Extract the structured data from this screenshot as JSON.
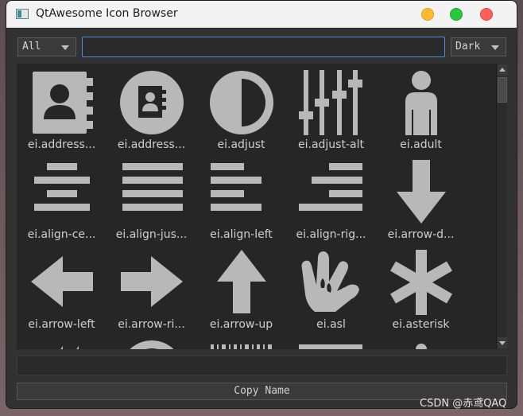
{
  "window": {
    "title": "QtAwesome Icon Browser"
  },
  "toolbar": {
    "filter_value": "All",
    "search_value": "",
    "theme_value": "Dark"
  },
  "icons": [
    {
      "label": "ei.address...",
      "icon": "address-book-icon"
    },
    {
      "label": "ei.address...",
      "icon": "address-book-alt-icon"
    },
    {
      "label": "ei.adjust",
      "icon": "adjust-icon"
    },
    {
      "label": "ei.adjust-alt",
      "icon": "adjust-alt-icon"
    },
    {
      "label": "ei.adult",
      "icon": "adult-icon"
    },
    {
      "label": "ei.align-ce...",
      "icon": "align-center-icon"
    },
    {
      "label": "ei.align-jus...",
      "icon": "align-justify-icon"
    },
    {
      "label": "ei.align-left",
      "icon": "align-left-icon"
    },
    {
      "label": "ei.align-rig...",
      "icon": "align-right-icon"
    },
    {
      "label": "ei.arrow-d...",
      "icon": "arrow-down-icon"
    },
    {
      "label": "ei.arrow-left",
      "icon": "arrow-left-icon"
    },
    {
      "label": "ei.arrow-ri...",
      "icon": "arrow-right-icon"
    },
    {
      "label": "ei.arrow-up",
      "icon": "arrow-up-icon"
    },
    {
      "label": "ei.asl",
      "icon": "asl-icon"
    },
    {
      "label": "ei.asterisk",
      "icon": "asterisk-icon"
    }
  ],
  "bottom": {
    "selected_name": "",
    "copy_label": "Copy Name"
  },
  "watermark": "CSDN @赤鸢QAQ",
  "colors": {
    "icon_fill": "#b8b8b8",
    "background": "#262626",
    "search_border": "#4a8fd4"
  }
}
